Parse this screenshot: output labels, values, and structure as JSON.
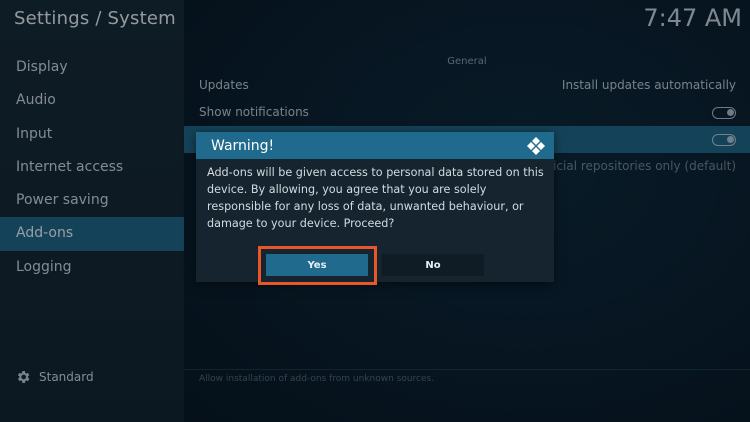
{
  "app": {
    "title": "Settings / System",
    "clock": "7:47 AM"
  },
  "sidebar": {
    "items": [
      {
        "label": "Display",
        "active": false
      },
      {
        "label": "Audio",
        "active": false
      },
      {
        "label": "Input",
        "active": false
      },
      {
        "label": "Internet access",
        "active": false
      },
      {
        "label": "Power saving",
        "active": false
      },
      {
        "label": "Add-ons",
        "active": true
      },
      {
        "label": "Logging",
        "active": false
      }
    ],
    "settings_level": {
      "icon": "gear-icon",
      "label": "Standard"
    }
  },
  "main": {
    "section_header": "General",
    "rows": [
      {
        "label": "Updates",
        "value": "Install updates automatically"
      },
      {
        "label": "Show notifications",
        "toggle": "off"
      },
      {
        "label": "",
        "toggle": "on"
      },
      {
        "label": "",
        "value": "Official repositories only (default)"
      }
    ],
    "footer_hint": "Allow installation of add-ons from unknown sources."
  },
  "dialog": {
    "title": "Warning!",
    "logo": "kodi-logo-icon",
    "message": "Add-ons will be given access to personal data stored on this device. By allowing, you agree that you are solely responsible for any loss of data, unwanted behaviour, or damage to your device. Proceed?",
    "yes_label": "Yes",
    "no_label": "No"
  },
  "colors": {
    "accent": "#1f6a8d",
    "annotation_outline": "#e9562a"
  }
}
